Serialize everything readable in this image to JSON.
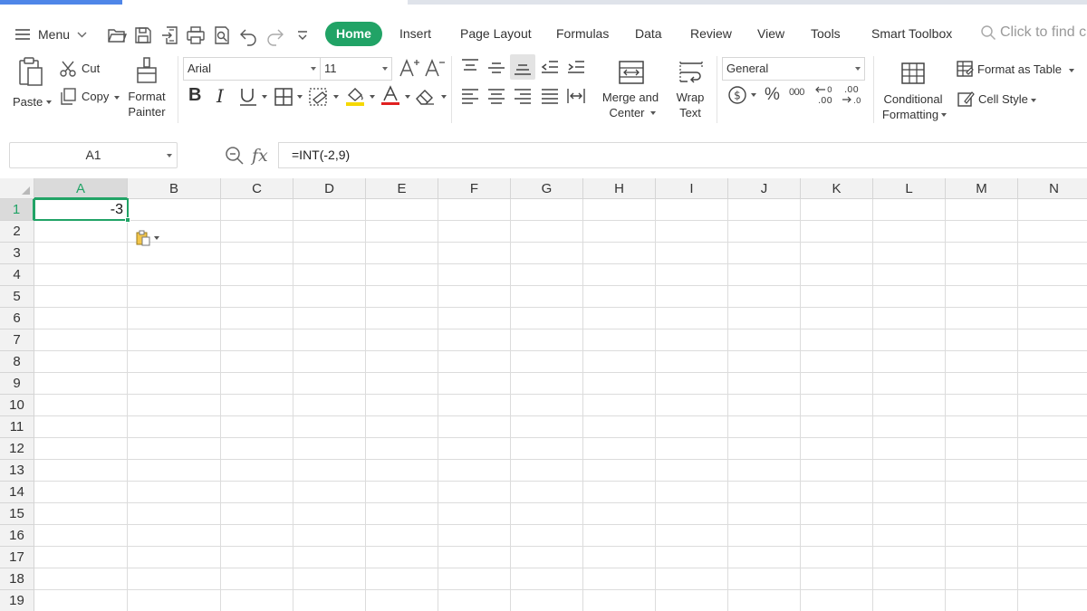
{
  "menubar": {
    "menu_label": "Menu",
    "tabs": [
      {
        "label": "Home",
        "active": true
      },
      {
        "label": "Insert"
      },
      {
        "label": "Page Layout"
      },
      {
        "label": "Formulas"
      },
      {
        "label": "Data"
      },
      {
        "label": "Review"
      },
      {
        "label": "View"
      },
      {
        "label": "Tools"
      },
      {
        "label": "Smart Toolbox"
      }
    ],
    "search_placeholder": "Click to find c",
    "quick_access_icons": [
      "open-icon",
      "save-icon",
      "export-icon",
      "print-icon",
      "print-preview-icon",
      "undo-icon",
      "redo-icon",
      "customize-icon"
    ]
  },
  "ribbon": {
    "paste_label": "Paste",
    "cut_label": "Cut",
    "copy_label": "Copy",
    "format_painter_label_1": "Format",
    "format_painter_label_2": "Painter",
    "font_name": "Arial",
    "font_size": "11",
    "merge_label_1": "Merge and",
    "merge_label_2": "Center",
    "wrap_label_1": "Wrap",
    "wrap_label_2": "Text",
    "number_format": "General",
    "conditional_label_1": "Conditional",
    "conditional_label_2": "Formatting",
    "format_table_label": "Format as Table",
    "cell_style_label": "Cell Style",
    "colors": {
      "accent": "#21a366",
      "font_color": "#e02020",
      "fill_color": "#f5d800"
    }
  },
  "formula_bar": {
    "name_box": "A1",
    "fx_label": "fx",
    "formula": "=INT(-2,9)"
  },
  "sheet": {
    "columns": [
      "A",
      "B",
      "C",
      "D",
      "E",
      "F",
      "G",
      "H",
      "I",
      "J",
      "K",
      "L",
      "M",
      "N"
    ],
    "rows": [
      "1",
      "2",
      "3",
      "4",
      "5",
      "6",
      "7",
      "8",
      "9",
      "10",
      "11",
      "12",
      "13",
      "14",
      "15",
      "16",
      "17",
      "18",
      "19"
    ],
    "selected_cell": "A1",
    "a1_value": "-3"
  }
}
